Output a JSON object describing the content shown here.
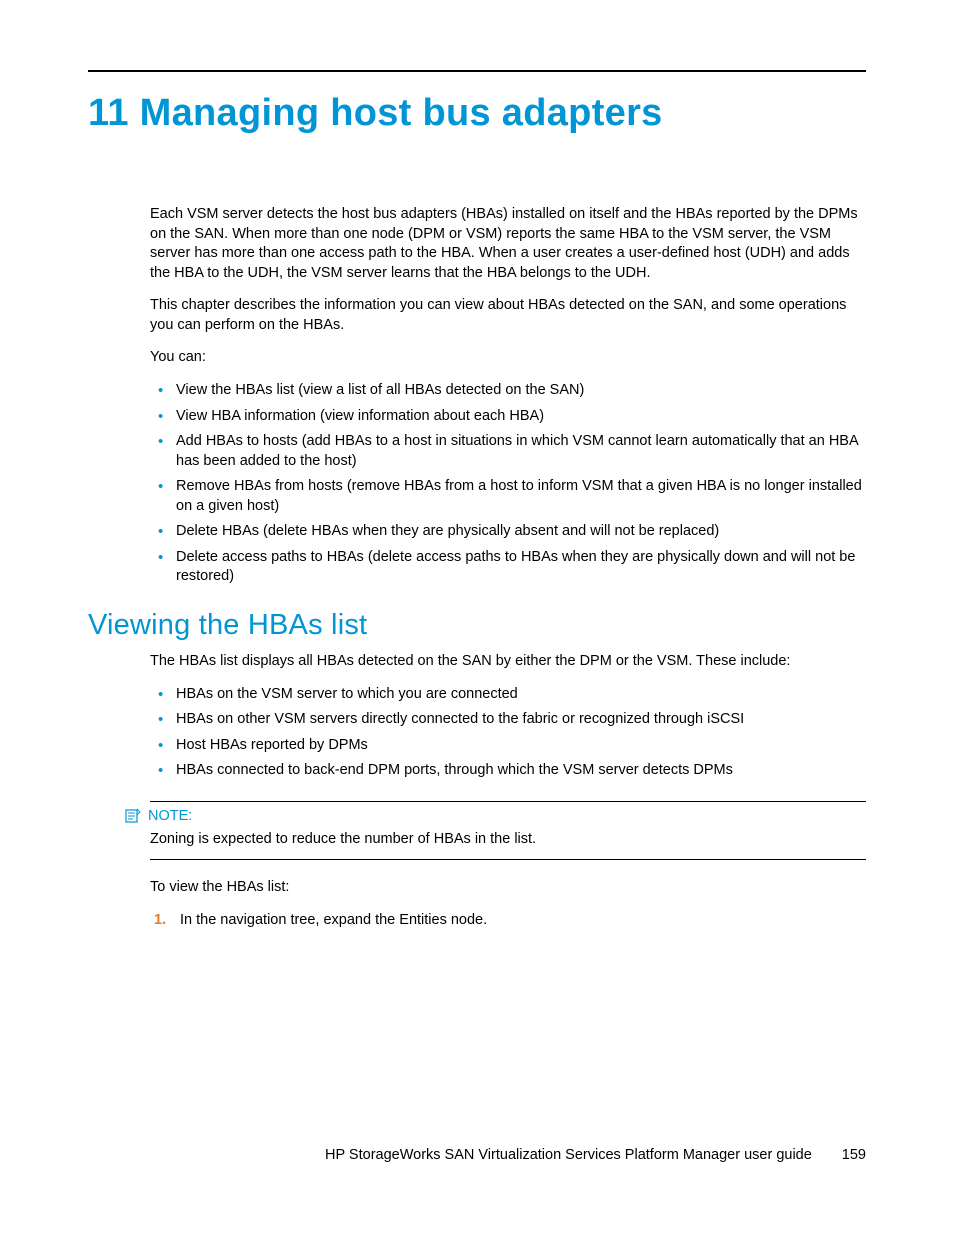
{
  "chapter": {
    "title": "11 Managing host bus adapters"
  },
  "intro": {
    "p1": "Each VSM server detects the host bus adapters (HBAs) installed on itself and the HBAs reported by the DPMs on the SAN. When more than one node (DPM or VSM) reports the same HBA to the VSM server, the VSM server has more than one access path to the HBA. When a user creates a user-defined host (UDH) and adds the HBA to the UDH, the VSM server learns that the HBA belongs to the UDH.",
    "p2": "This chapter describes the information you can view about HBAs detected on the SAN, and some operations you can perform on the HBAs.",
    "p3": "You can:",
    "bullets": {
      "b0": "View the HBAs list (view a list of all HBAs detected on the SAN)",
      "b1": "View HBA information (view information about each HBA)",
      "b2": "Add HBAs to hosts (add HBAs to a host in situations in which VSM cannot learn automatically that an HBA has been added to the host)",
      "b3": "Remove HBAs from hosts (remove HBAs from a host to inform VSM that a given HBA is no longer installed on a given host)",
      "b4": "Delete HBAs (delete HBAs when they are physically absent and will not be replaced)",
      "b5": "Delete access paths to HBAs (delete access paths to HBAs when they are physically down and will not be restored)"
    }
  },
  "section1": {
    "heading": "Viewing the HBAs list",
    "p1": "The HBAs list displays all HBAs detected on the SAN by either the DPM or the VSM. These include:",
    "bullets": {
      "b0": "HBAs on the VSM server to which you are connected",
      "b1": "HBAs on other VSM servers directly connected to the fabric or recognized through iSCSI",
      "b2": "Host HBAs reported by DPMs",
      "b3": "HBAs connected to back-end DPM ports, through which the VSM server detects DPMs"
    },
    "note": {
      "label": "NOTE:",
      "text": "Zoning is expected to reduce the number of HBAs in the list."
    },
    "p2": "To view the HBAs list:",
    "steps": {
      "s1_num": "1.",
      "s1_text": "In the navigation tree, expand the Entities node."
    }
  },
  "footer": {
    "doc_title": "HP StorageWorks SAN Virtualization Services Platform Manager user guide",
    "page_number": "159"
  },
  "colors": {
    "accent": "#0096d6",
    "step_number": "#e87722"
  }
}
